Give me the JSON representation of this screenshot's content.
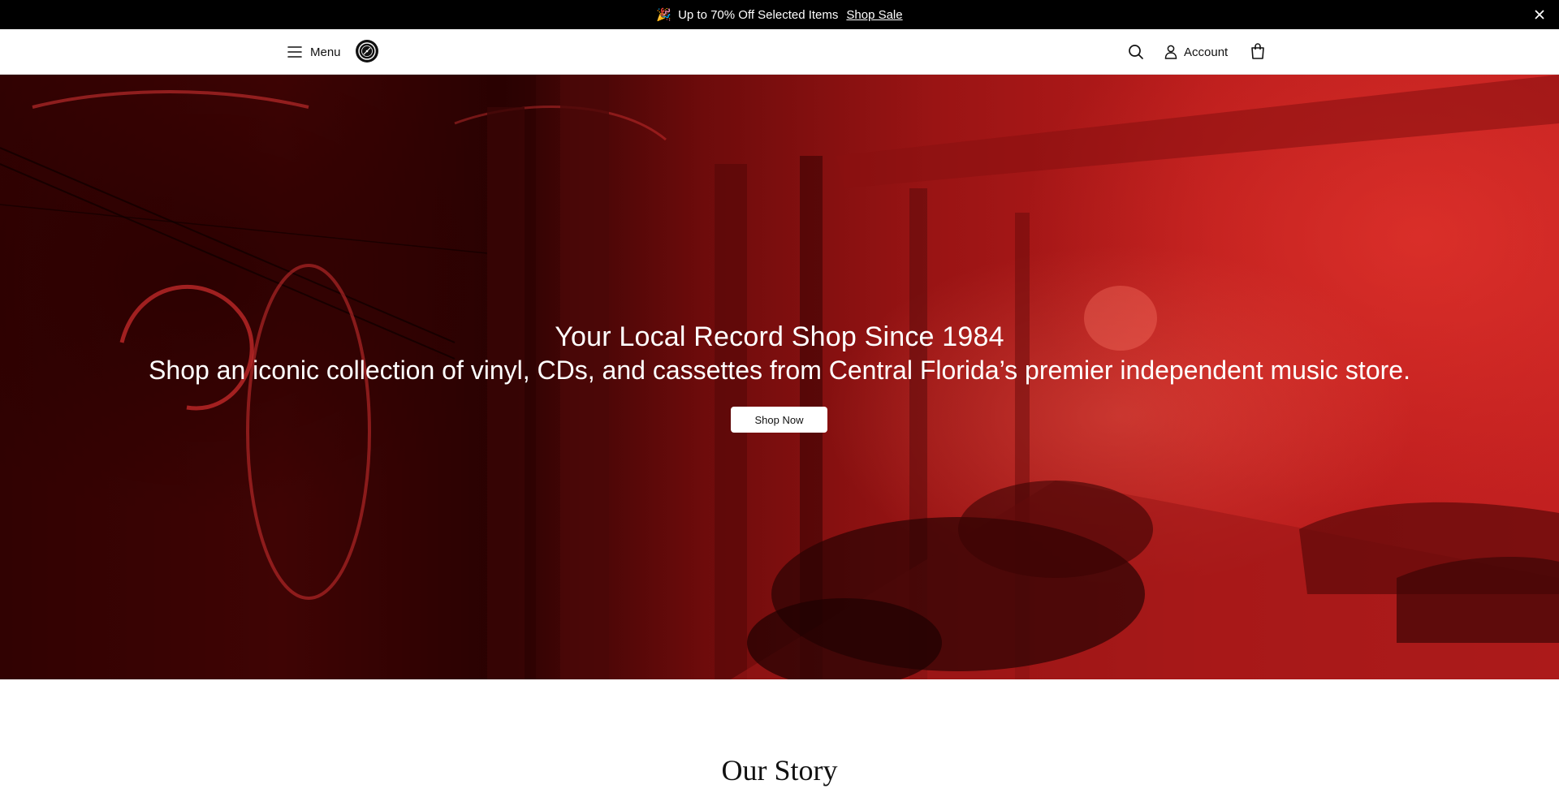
{
  "announcement": {
    "emoji": "🎉",
    "text": "Up to 70% Off Selected Items",
    "link_label": "Shop Sale",
    "close_icon": "close-icon"
  },
  "header": {
    "menu_label": "Menu",
    "account_label": "Account",
    "icons": [
      "menu-icon",
      "logo-icon",
      "search-icon",
      "user-icon",
      "shopping-bag-icon"
    ]
  },
  "hero": {
    "title": "Your Local Record Shop Since 1984",
    "subtitle": "Shop an iconic collection of vinyl, CDs, and cassettes from Central Florida’s premier independent music store.",
    "cta_label": "Shop Now",
    "tint_color": "#b81b1b"
  },
  "story": {
    "title": "Our Story"
  },
  "colors": {
    "announcement_bg": "#000000",
    "header_bg": "#ffffff",
    "hero_tint": "#b81b1b",
    "button_bg": "#ffffff"
  }
}
